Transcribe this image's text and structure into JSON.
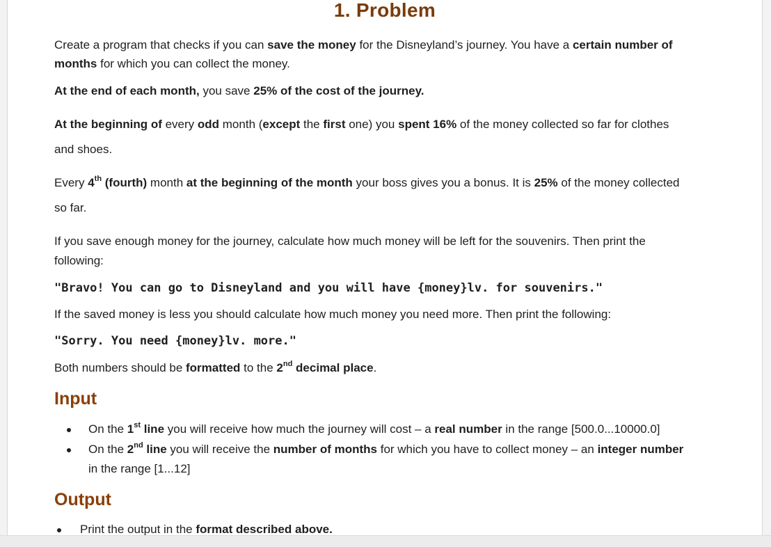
{
  "title": "1. Problem",
  "intro": {
    "l1a": "Create a program that checks if you can ",
    "l1b": "save the money",
    "l1c": " for the Disneyland’s journey. You have a ",
    "l1d": "certain number of",
    "l2a": "months",
    "l2b": " for which you can collect the money."
  },
  "save": {
    "a": "At the end of each month,",
    "b": " you save ",
    "c": "25% of the cost of the journey."
  },
  "spend": {
    "a": "At the beginning of",
    "b": " every ",
    "c": "odd",
    "d": " month (",
    "e": "except",
    "f": " the ",
    "g": "first",
    "h": " one) you ",
    "i": "spent 16%",
    "j": " of the money collected so far for clothes",
    "k": "and shoes."
  },
  "bonus": {
    "a": "Every ",
    "b": "4",
    "b_sup": "th",
    "c": " (fourth)",
    "d": " month ",
    "e": "at the beginning of the month",
    "f": " your boss gives you a bonus. It is ",
    "g": "25%",
    "h": " of the money collected",
    "i": "so far."
  },
  "enough": {
    "l1": "If you save enough money for the journey, calculate how much money will be left for the souvenirs. Then print the",
    "l2": "following:"
  },
  "bravo": "\"Bravo! You can go to Disneyland and you will have {money}lv. for souvenirs.\"",
  "less": "If the saved money is less you should calculate how much money you need more. Then print the following:",
  "sorry": "\"Sorry. You need {money}lv. more.\"",
  "format": {
    "a": "Both numbers should be ",
    "b": "formatted",
    "c": " to the ",
    "d": "2",
    "d_sup": "nd",
    "e": " decimal place",
    "f": "."
  },
  "input": {
    "heading": "Input",
    "b1": {
      "a": "On the ",
      "b": "1",
      "b_sup": "st",
      "c": " line",
      "d": " you will receive how much the journey will cost – a ",
      "e": "real number",
      "f": " in the range [500.0...10000.0]"
    },
    "b2": {
      "a": "On the ",
      "b": "2",
      "b_sup": "nd",
      "c": " line",
      "d": " you will receive the ",
      "e": "number of months",
      "f": " for which you have to collect money – an ",
      "g": "integer number",
      "h": "in the range [1...12]"
    }
  },
  "output": {
    "heading": "Output",
    "b1a": "Print the output in the ",
    "b1b": "format described above."
  }
}
